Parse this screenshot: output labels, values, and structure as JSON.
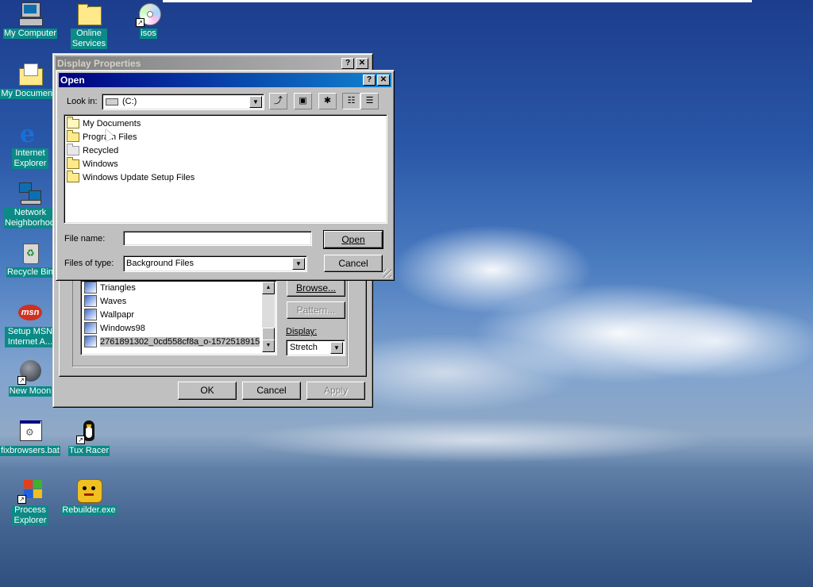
{
  "desktop": {
    "icons": [
      {
        "label": "My Computer",
        "icon": "computer-icon"
      },
      {
        "label": "Online Services",
        "icon": "folder-icon"
      },
      {
        "label": "isos",
        "icon": "cd-icon"
      },
      {
        "label": "My Documents",
        "icon": "documents-folder-icon"
      },
      {
        "label": "Internet Explorer",
        "icon": "internet-explorer-icon"
      },
      {
        "label": "Network Neighborhood",
        "icon": "network-icon"
      },
      {
        "label": "Recycle Bin",
        "icon": "recycle-bin-icon"
      },
      {
        "label": "Setup MSN Internet A...",
        "icon": "msn-icon"
      },
      {
        "label": "New Moon",
        "icon": "moon-icon"
      },
      {
        "label": "fixbrowsers.bat",
        "icon": "batch-file-icon"
      },
      {
        "label": "Tux Racer",
        "icon": "penguin-icon"
      },
      {
        "label": "Process Explorer",
        "icon": "process-explorer-icon"
      },
      {
        "label": "Rebuilder.exe",
        "icon": "rebuilder-icon"
      }
    ]
  },
  "display_properties": {
    "title": "Display Properties",
    "help_glyph": "?",
    "close_glyph": "✕",
    "wallpaper_list": [
      "Triangles",
      "Waves",
      "Wallpapr",
      "Windows98",
      "2761891302_0cd558cf8a_o-1572518915"
    ],
    "browse_label": "Browse...",
    "pattern_label": "Pattern...",
    "display_label": "Display:",
    "display_value": "Stretch",
    "ok_label": "OK",
    "cancel_label": "Cancel",
    "apply_label": "Apply"
  },
  "open_dialog": {
    "title": "Open",
    "help_glyph": "?",
    "close_glyph": "✕",
    "look_in_label": "Look in:",
    "look_in_value": "(C:)",
    "files": [
      {
        "name": "My Documents",
        "type": "open"
      },
      {
        "name": "Program Files",
        "type": "folder"
      },
      {
        "name": "Recycled",
        "type": "gray"
      },
      {
        "name": "Windows",
        "type": "folder"
      },
      {
        "name": "Windows Update Setup Files",
        "type": "folder"
      }
    ],
    "file_name_label": "File name:",
    "file_name_value": "",
    "files_of_type_label": "Files of type:",
    "files_of_type_value": "Background Files",
    "open_label": "Open",
    "cancel_label": "Cancel"
  }
}
